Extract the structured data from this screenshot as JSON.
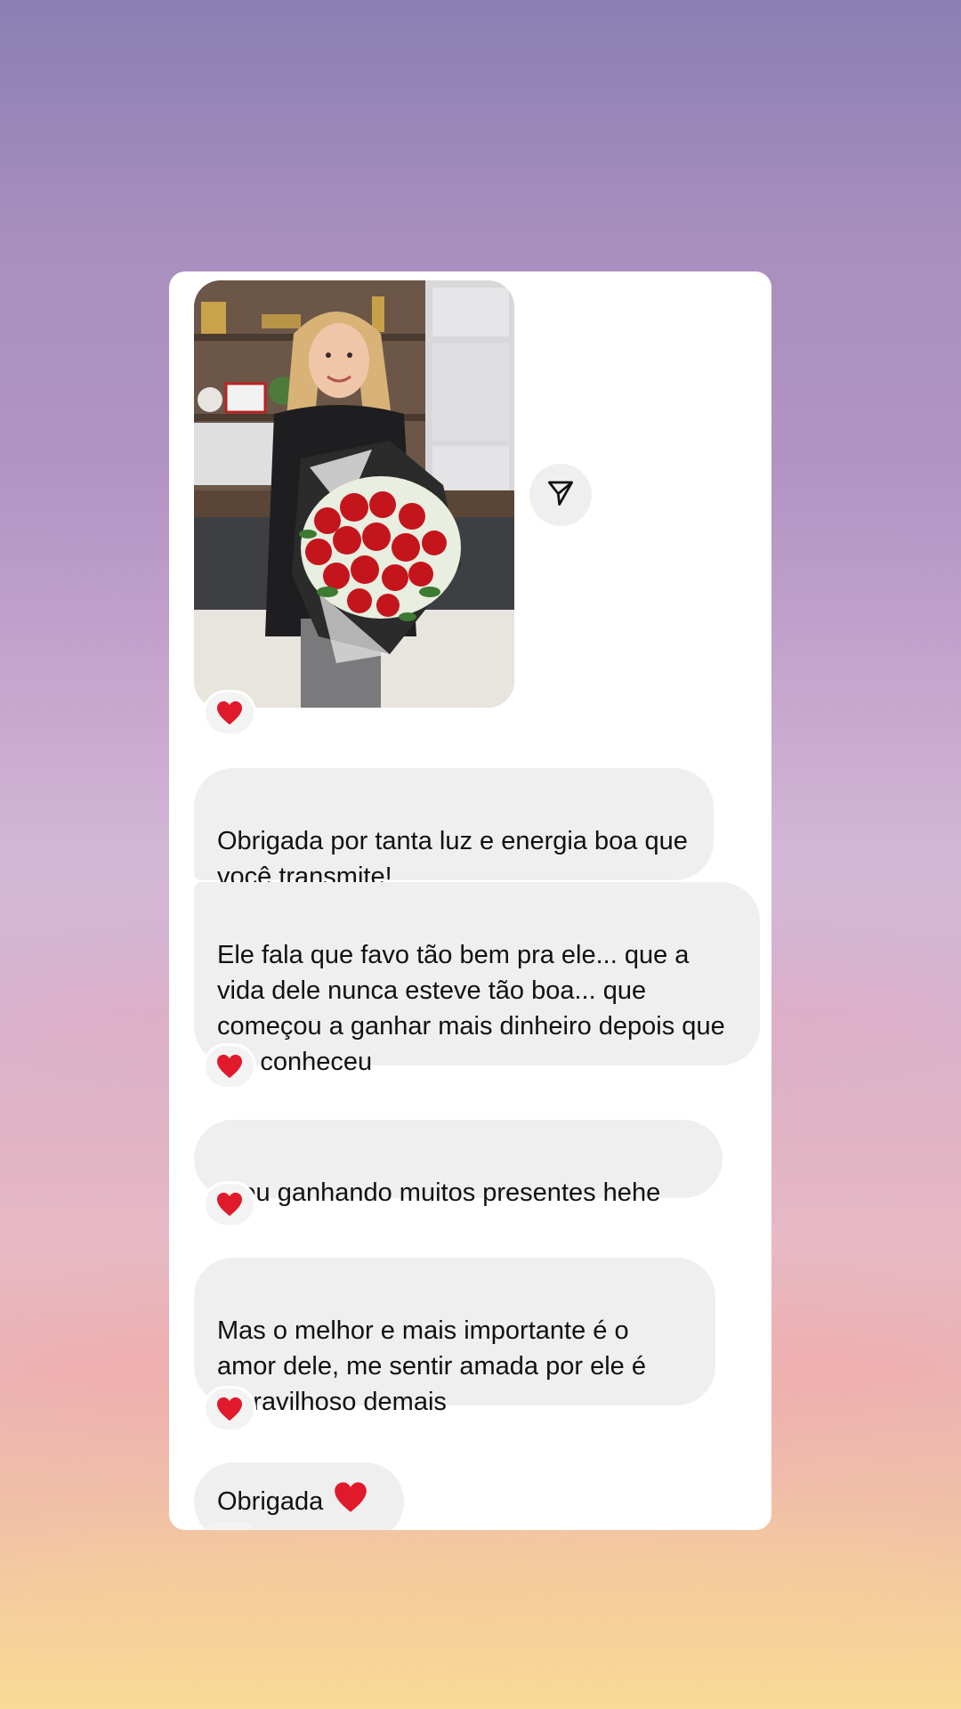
{
  "conversation": {
    "messages": [
      {
        "text": "Obrigada por tanta luz e energia boa que você transmite!",
        "reaction": "heart"
      },
      {
        "text": "Ele fala que favo tão bem pra ele... que a vida dele nunca esteve tão boa... que começou a ganhar mais dinheiro depois que me conheceu",
        "reaction": "heart"
      },
      {
        "text": "E eu ganhando muitos presentes hehe",
        "reaction": "heart"
      },
      {
        "text": "Mas o melhor e mais importante é o amor dele, me sentir amada por ele é maravilhoso demais",
        "reaction": "heart"
      },
      {
        "text": "Obrigada",
        "emoji": "heart"
      }
    ],
    "photo": {
      "reaction": "heart"
    },
    "share_icon": "send-icon",
    "colors": {
      "bubble": "#efefef",
      "heart": "#e0192b",
      "card": "#ffffff"
    }
  }
}
